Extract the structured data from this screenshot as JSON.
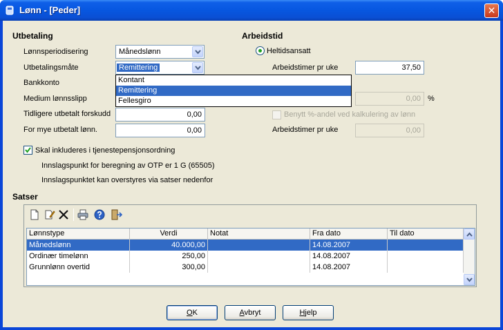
{
  "window": {
    "title": "Lønn - [Peder]",
    "close_glyph": "✕"
  },
  "utbetaling": {
    "heading": "Utbetaling",
    "lonnsperiodisering_label": "Lønnsperiodisering",
    "lonnsperiodisering_value": "Månedslønn",
    "utbetalingsmate_label": "Utbetalingsmåte",
    "utbetalingsmate_value": "Remittering",
    "options": [
      "Kontant",
      "Remittering",
      "Fellesgiro"
    ],
    "bankkonto_label": "Bankkonto",
    "medium_label": "Medium lønnsslipp",
    "tidligere_label": "Tidligere utbetalt forskudd",
    "tidligere_value": "0,00",
    "formye_label": "For mye utbetalt lønn.",
    "formye_value": "0,00"
  },
  "arbeidstid": {
    "heading": "Arbeidstid",
    "heltid_label": "Heltidsansatt",
    "timer_label": "Arbeidstimer pr uke",
    "timer_value": "37,50",
    "percent_value": "0,00",
    "percent_unit": "%",
    "benytt_label": "Benytt %-andel ved kalkulering av lønn",
    "timer2_label": "Arbeidstimer pr uke",
    "timer2_value": "0,00"
  },
  "pensjon": {
    "checkbox_label": "Skal inkluderes i tjenestepensjonsordning",
    "info1": "Innslagspunkt for beregning av OTP er 1 G (65505)",
    "info2": "Innslagspunktet kan overstyres via satser nedenfor"
  },
  "satser": {
    "heading": "Satser",
    "toolbar": [
      "new-icon",
      "edit-icon",
      "delete-icon",
      "print-icon",
      "help-icon",
      "exit-icon"
    ],
    "columns": [
      "Lønnstype",
      "Verdi",
      "Notat",
      "Fra dato",
      "Til dato"
    ],
    "rows": [
      {
        "type": "Månedslønn",
        "verdi": "40.000,00",
        "notat": "",
        "fra": "14.08.2007",
        "til": ""
      },
      {
        "type": "Ordinær timelønn",
        "verdi": "250,00",
        "notat": "",
        "fra": "14.08.2007",
        "til": ""
      },
      {
        "type": "Grunnlønn overtid",
        "verdi": "300,00",
        "notat": "",
        "fra": "14.08.2007",
        "til": ""
      }
    ]
  },
  "buttons": {
    "ok_mn": "O",
    "ok_rest": "K",
    "avbryt_mn": "A",
    "avbryt_rest": "vbryt",
    "hjelp_mn": "H",
    "hjelp_rest": "jelp"
  },
  "colors": {
    "titlebar": "#0757e0",
    "selection": "#316ac5",
    "dialog_bg": "#ece9d8"
  }
}
